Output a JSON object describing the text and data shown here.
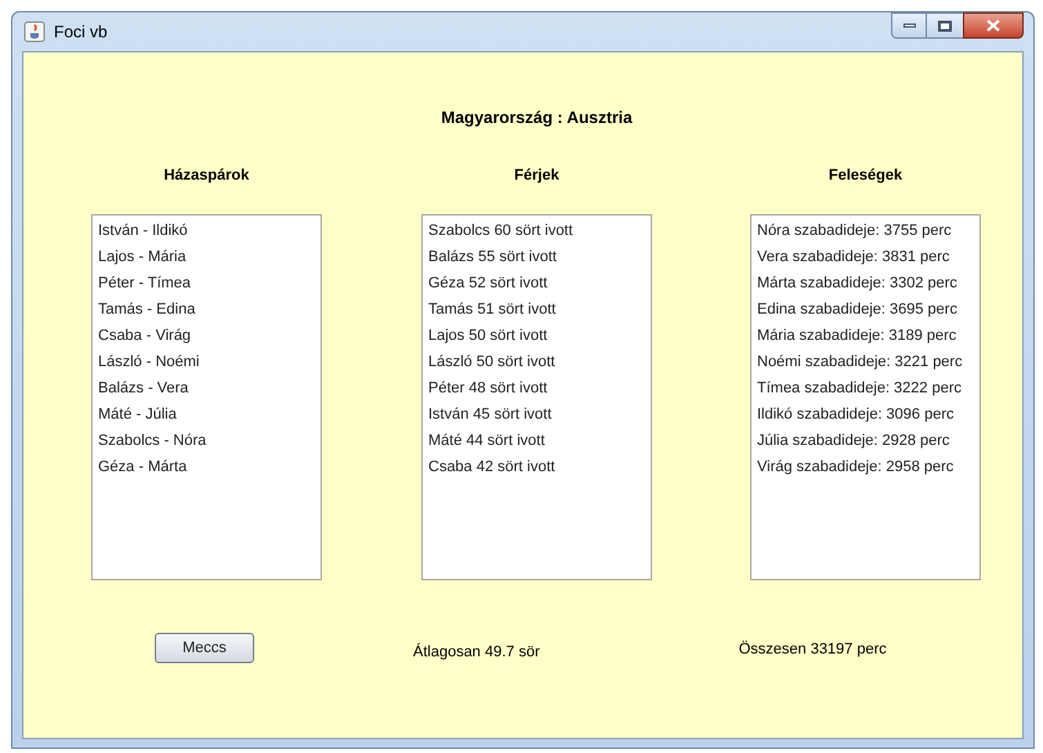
{
  "window": {
    "title": "Foci vb"
  },
  "match_title": "Magyarország : Ausztria",
  "columns": [
    {
      "heading": "Házaspárok",
      "items": [
        "István - Ildikó",
        "Lajos - Mária",
        "Péter - Tímea",
        "Tamás - Edina",
        "Csaba - Virág",
        "László - Noémi",
        "Balázs - Vera",
        "Máté - Júlia",
        "Szabolcs - Nóra",
        "Géza - Márta"
      ]
    },
    {
      "heading": "Férjek",
      "items": [
        "Szabolcs 60 sört ivott",
        "Balázs 55 sört ivott",
        "Géza 52 sört ivott",
        "Tamás 51 sört ivott",
        "Lajos 50 sört ivott",
        "László 50 sört ivott",
        "Péter 48 sört ivott",
        "István 45 sört ivott",
        "Máté 44 sört ivott",
        "Csaba 42 sört ivott"
      ]
    },
    {
      "heading": "Feleségek",
      "items": [
        "Nóra szabadideje: 3755 perc",
        "Vera szabadideje: 3831 perc",
        "Márta szabadideje: 3302 perc",
        "Edina szabadideje: 3695 perc",
        "Mária szabadideje: 3189 perc",
        "Noémi szabadideje: 3221 perc",
        "Tímea szabadideje: 3222 perc",
        "Ildikó szabadideje: 3096 perc",
        "Júlia szabadideje: 2928 perc",
        "Virág szabadideje: 2958 perc"
      ]
    }
  ],
  "button": "Meccs",
  "average": "Átlagosan 49.7 sör",
  "total": "Összesen 33197 perc"
}
